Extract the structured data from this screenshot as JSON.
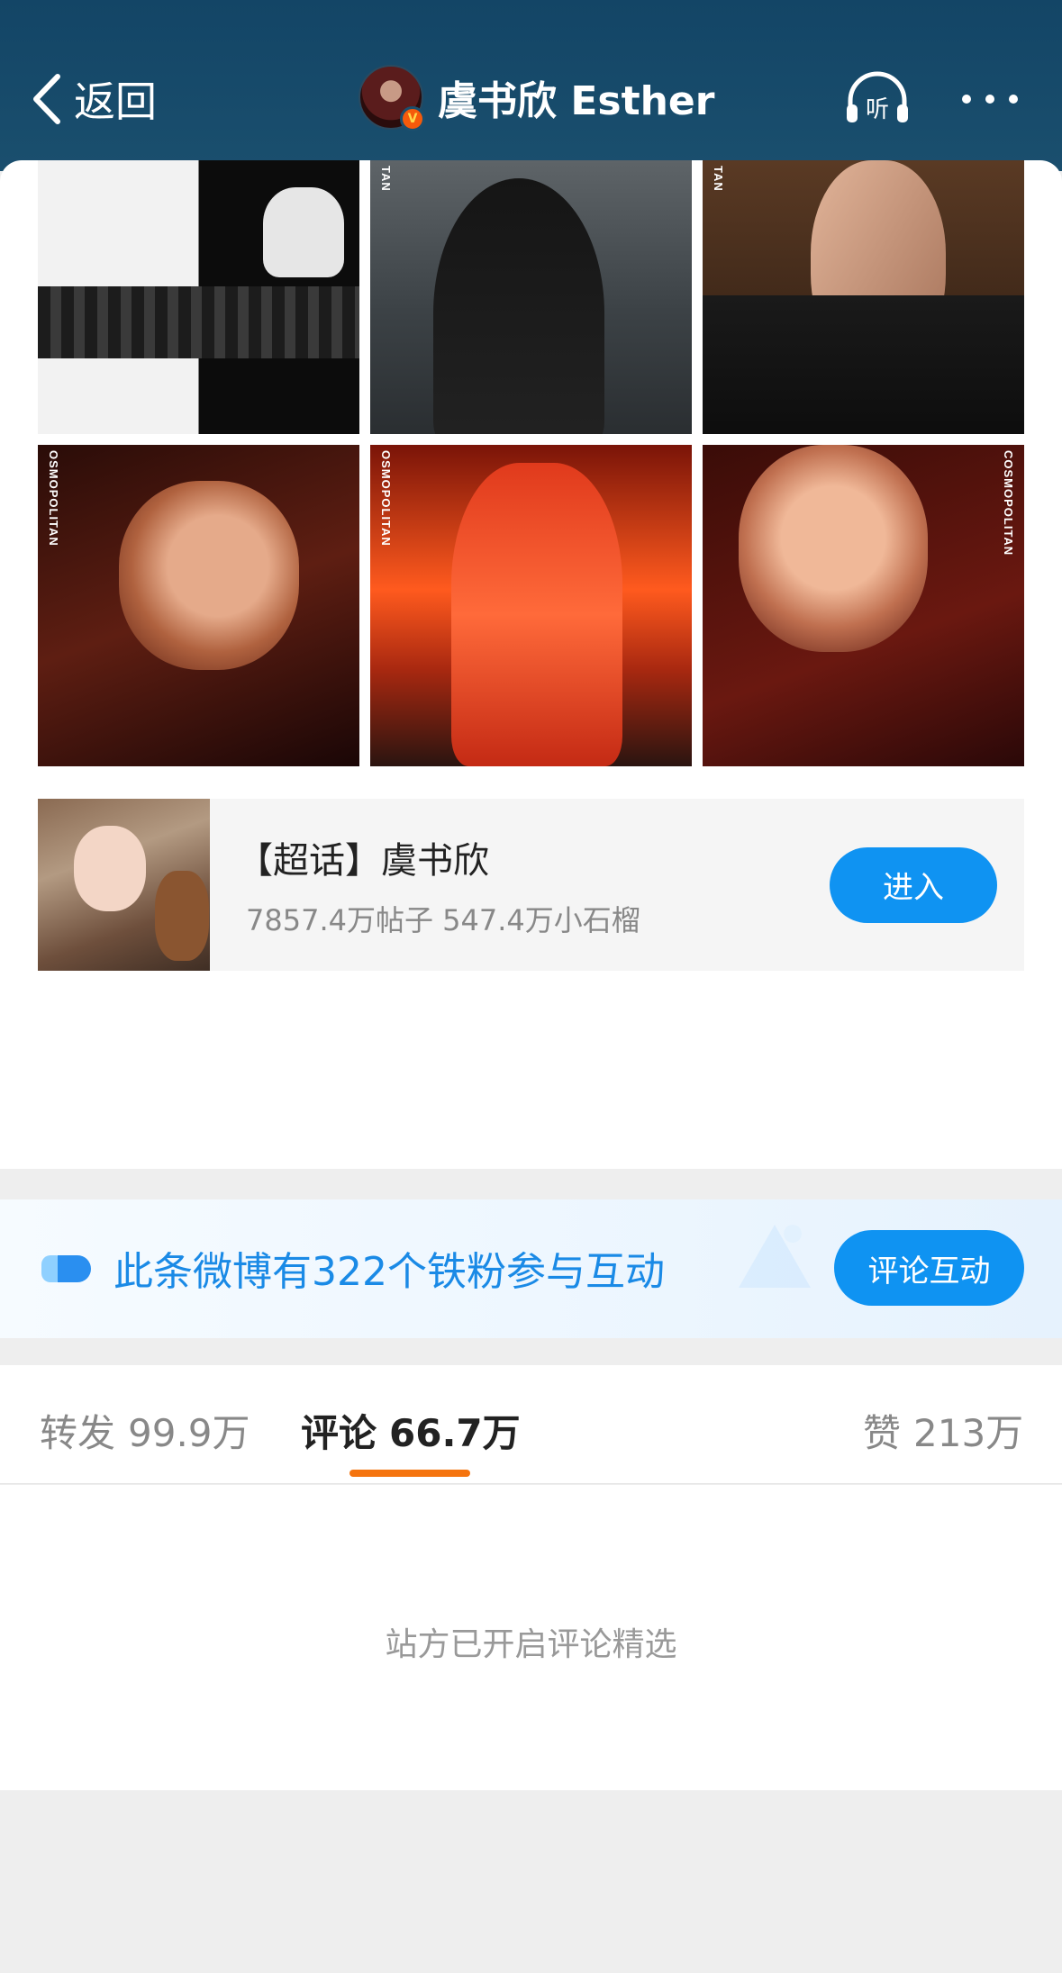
{
  "header": {
    "back_label": "返回",
    "title": "虞书欣 Esther",
    "listen_label": "听",
    "verified_mark": "V"
  },
  "photos": [
    {
      "name": "photo-1",
      "magazine": ""
    },
    {
      "name": "photo-2",
      "magazine": "TAN"
    },
    {
      "name": "photo-3",
      "magazine": "TAN"
    },
    {
      "name": "photo-4",
      "magazine": "OSMOPOLITAN"
    },
    {
      "name": "photo-5",
      "magazine": "OSMOPOLITAN"
    },
    {
      "name": "photo-6",
      "magazine": "COSMOPOLITAN"
    }
  ],
  "supertopic": {
    "title": "【超话】虞书欣",
    "stats": "7857.4万帖子 547.4万小石榴",
    "enter_label": "进入"
  },
  "share": [
    {
      "name": "wechat",
      "color": "#22c17a"
    },
    {
      "name": "moments",
      "color": "#5ac33a"
    },
    {
      "name": "qq",
      "color": "#19a7f0"
    },
    {
      "name": "save-image",
      "color": "#f5a20f"
    }
  ],
  "fans_banner": {
    "text": "此条微博有322个铁粉参与互动",
    "button_label": "评论互动"
  },
  "tabs": [
    {
      "label": "转发",
      "count": "99.9万"
    },
    {
      "label": "评论",
      "count": "66.7万"
    },
    {
      "label": "赞",
      "count": "213万"
    }
  ],
  "comments": {
    "notice": "站方已开启评论精选"
  },
  "colors": {
    "header_bg": "#134566",
    "accent_blue": "#0f93f2",
    "tab_underline": "#f5740e"
  }
}
